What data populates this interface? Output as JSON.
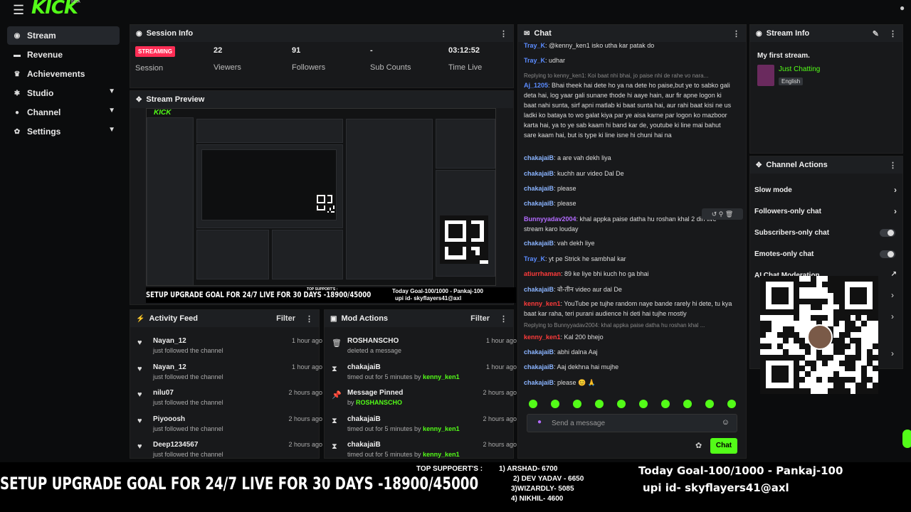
{
  "app": {
    "logo": "KICK",
    "beta": "BETA"
  },
  "sidebar": {
    "items": [
      {
        "label": "Stream",
        "icon": "broadcast-icon"
      },
      {
        "label": "Revenue",
        "icon": "money-icon"
      },
      {
        "label": "Achievements",
        "icon": "trophy-icon"
      },
      {
        "label": "Studio",
        "icon": "palette-icon"
      },
      {
        "label": "Channel",
        "icon": "user-icon"
      },
      {
        "label": "Settings",
        "icon": "gear-icon"
      }
    ]
  },
  "session": {
    "title": "Session Info",
    "status": "STREAMING",
    "status_label": "Session",
    "stats": [
      {
        "value": "22",
        "label": "Viewers"
      },
      {
        "value": "91",
        "label": "Followers"
      },
      {
        "value": "-",
        "label": "Sub Counts"
      },
      {
        "value": "03:12:52",
        "label": "Time Live"
      }
    ]
  },
  "preview": {
    "title": "Stream Preview",
    "overlay_goal": "SETUP UPGRADE GOAL FOR 24/7 LIVE  FOR 30 DAYS -18900/45000",
    "overlay_today": "Today Goal-100/1000 - Pankaj-100",
    "overlay_upi": "upi id- skyflayers41@axl",
    "overlay_top": "TOP SUPPORT'S :"
  },
  "activity": {
    "title": "Activity Feed",
    "filter": "Filter",
    "items": [
      {
        "name": "Nayan_12",
        "desc": "just followed the channel",
        "time": "1 hour ago"
      },
      {
        "name": "Nayan_12",
        "desc": "just followed the channel",
        "time": "1 hour ago"
      },
      {
        "name": "nilu07",
        "desc": "just followed the channel",
        "time": "2 hours ago"
      },
      {
        "name": "Piyooosh",
        "desc": "just followed the channel",
        "time": "2 hours ago"
      },
      {
        "name": "Deep1234567",
        "desc": "just followed the channel",
        "time": "2 hours ago"
      }
    ]
  },
  "mod": {
    "title": "Mod Actions",
    "filter": "Filter",
    "items": [
      {
        "name": "ROSHANSCHO",
        "desc": "deleted a message",
        "by": "",
        "time": "1 hour ago",
        "icon": "trash-icon"
      },
      {
        "name": "chakajaiB",
        "desc": "timed out for 5 minutes by ",
        "by": "kenny_ken1",
        "time": "1 hour ago",
        "icon": "hourglass-icon"
      },
      {
        "name": "Message Pinned",
        "desc": "by ",
        "by": "ROSHANSCHO",
        "time": "2 hours ago",
        "icon": "pin-icon"
      },
      {
        "name": "chakajaiB",
        "desc": "timed out for 5 minutes by ",
        "by": "kenny_ken1",
        "time": "2 hours ago",
        "icon": "hourglass-icon"
      },
      {
        "name": "chakajaiB",
        "desc": "timed out for 5 minutes by ",
        "by": "kenny_ken1",
        "time": "2 hours ago",
        "icon": "hourglass-icon"
      }
    ]
  },
  "chat": {
    "title": "Chat",
    "placeholder": "Send a message",
    "send": "Chat",
    "messages": [
      {
        "user": "Tray_K",
        "color": "#5b8cff",
        "text": ": @kenny_ken1 isko utha kar patak do"
      },
      {
        "user": "Tray_K",
        "color": "#5b8cff",
        "text": ": udhar"
      },
      {
        "reply": "Replying to kenny_ken1: Koi baat nhi bhai, jo paise nhi de rahe vo nara..."
      },
      {
        "user": "Aj_1205",
        "color": "#5b8cff",
        "text": ": Bhai theek hai dete ho ya na dete ho paise,but ye to sabko gali deta hai, log yaar gali sunane thode hi aaye hain, aur fir apne logon ki baat nahi sunta, sirf apni matlab ki baat sunta hai, aur rahi baat kisi ne us ladki ko bataya to wo galat kiya par ye aisa karne par logon ko mazboor karta hai, ya to ye sab kaam hi band kar de, youtube ki line mai bahut sare kaam hai, but is type ki line isne hi chuni hai na"
      },
      {
        "user": "chakajaiB",
        "color": "#8ab4ff",
        "text": ": a are vah dekh liya"
      },
      {
        "user": "chakajaiB",
        "color": "#8ab4ff",
        "text": ": kuchh aur video Dal De"
      },
      {
        "user": "chakajaiB",
        "color": "#8ab4ff",
        "text": ": please"
      },
      {
        "user": "chakajaiB",
        "color": "#8ab4ff",
        "text": ": please"
      },
      {
        "user": "Bunnyyadav2004",
        "color": "#b36bff",
        "text": ": khal appka paise datha hu roshan khal 2 din live stream karo louday"
      },
      {
        "user": "chakajaiB",
        "color": "#8ab4ff",
        "text": ": vah dekh liye"
      },
      {
        "user": "Tray_K",
        "color": "#5b8cff",
        "text": ": yt pe Strick he sambhal kar"
      },
      {
        "user": "atiurrhaman",
        "color": "#ff3b3b",
        "text": ": 89 ke liye bhi kuch ho ga bhai"
      },
      {
        "user": "chakajaiB",
        "color": "#8ab4ff",
        "text": ": वो-तीन video aur dal De"
      },
      {
        "user": "kenny_ken1",
        "color": "#ff3b3b",
        "text": ": YouTube pe tujhe random naye bande rarely hi dete, tu kya baat kar raha, teri purani audience hi deti hai tujhe mostly"
      },
      {
        "reply": "Replying to Bunnyyadav2004: khal appka paise datha hu roshan khal ..."
      },
      {
        "user": "kenny_ken1",
        "color": "#ff3b3b",
        "text": ": Kal 200 bhejo"
      },
      {
        "user": "chakajaiB",
        "color": "#8ab4ff",
        "text": ": abhi dalna Aaj"
      },
      {
        "user": "chakajaiB",
        "color": "#8ab4ff",
        "text": ": Aaj dekhna hai mujhe"
      },
      {
        "user": "chakajaiB",
        "color": "#8ab4ff",
        "text": ": please 😊 🙏"
      }
    ]
  },
  "streaminfo": {
    "title": "Stream Info",
    "name": "My first stream.",
    "category": "Just Chatting",
    "language": "English"
  },
  "channel_actions": {
    "title": "Channel Actions",
    "items": [
      {
        "label": "Slow mode",
        "type": "arrow"
      },
      {
        "label": "Followers-only chat",
        "type": "arrow"
      },
      {
        "label": "Subscribers-only chat",
        "type": "toggle"
      },
      {
        "label": "Emotes-only chat",
        "type": "toggle"
      },
      {
        "label": "AI Chat Moderation",
        "type": "link"
      }
    ]
  },
  "banner": {
    "goal": "SETUP UPGRADE GOAL FOR 24/7 LIVE  FOR 30 DAYS -18900/45000",
    "top_label": "TOP SUPPOERT'S :",
    "supporters": [
      "1) ARSHAD- 6700",
      "2) DEV YADAV - 6650",
      "3)WIZARDLY- 5085",
      "4) NIKHIL- 4600"
    ],
    "today": "Today Goal-100/1000 - Pankaj-100",
    "upi": "upi id- skyflayers41@axl"
  },
  "colors": {
    "accent": "#53fc18",
    "live": "#ff2d55"
  }
}
